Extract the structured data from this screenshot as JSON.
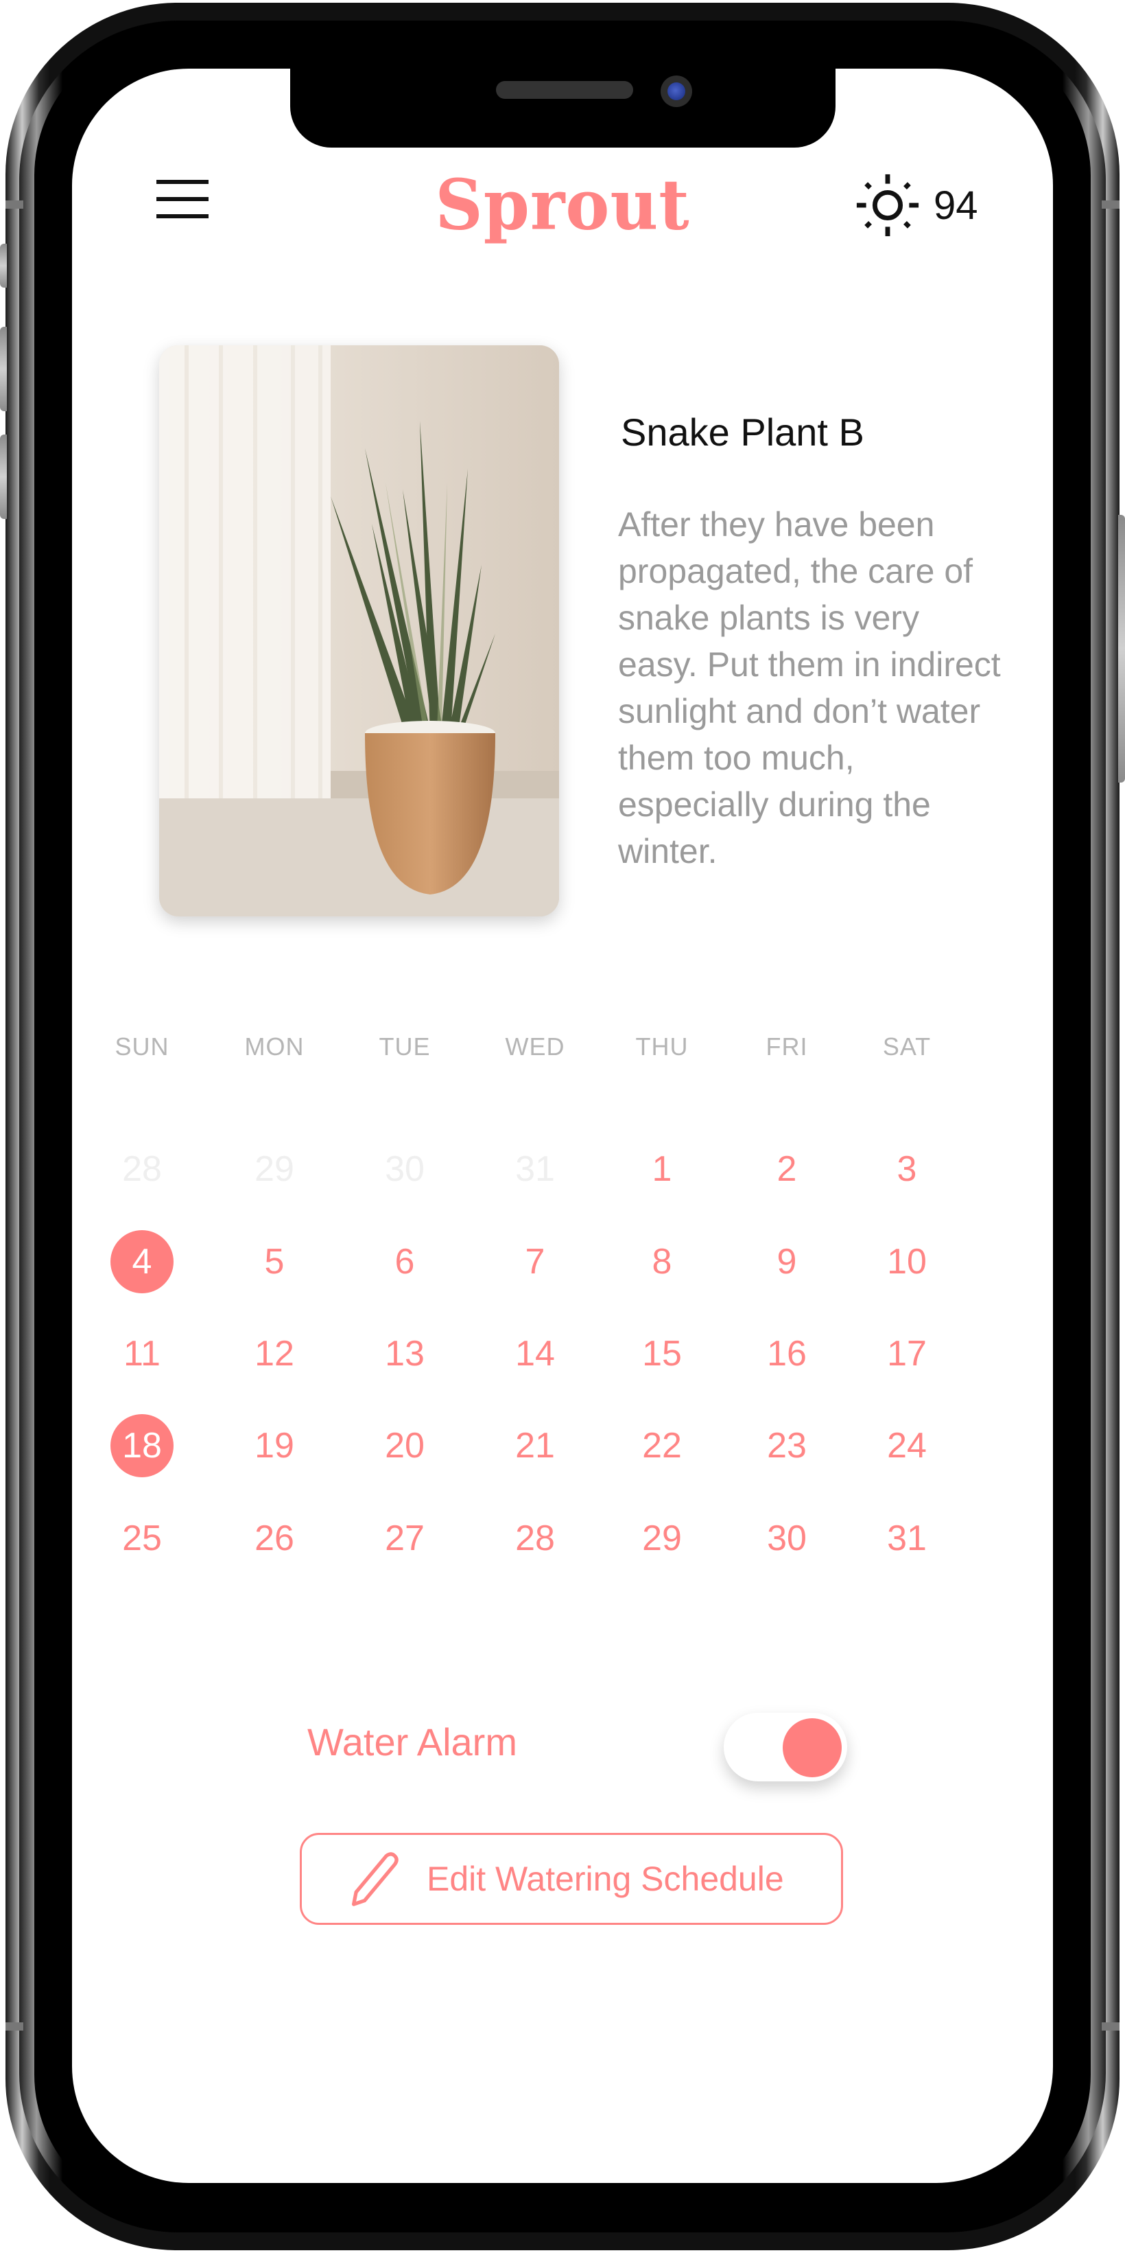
{
  "header": {
    "menu_icon": "hamburger-menu-icon",
    "app_title": "Sprout",
    "weather_icon": "sun-icon",
    "temperature": "94"
  },
  "plant": {
    "image_alt": "Snake plant in terracotta pot beside a curtain",
    "name": "Snake Plant B",
    "description": "After they have been propagated, the care of snake plants is very easy. Put them in indirect sunlight and don’t water them too much, especially during the winter."
  },
  "calendar": {
    "weekdays": [
      "SUN",
      "MON",
      "TUE",
      "WED",
      "THU",
      "FRI",
      "SAT"
    ],
    "weeks": [
      [
        {
          "d": "28",
          "muted": true
        },
        {
          "d": "29",
          "muted": true
        },
        {
          "d": "30",
          "muted": true
        },
        {
          "d": "31",
          "muted": true
        },
        {
          "d": "1"
        },
        {
          "d": "2"
        },
        {
          "d": "3"
        }
      ],
      [
        {
          "d": "4",
          "selected": true
        },
        {
          "d": "5"
        },
        {
          "d": "6"
        },
        {
          "d": "7"
        },
        {
          "d": "8"
        },
        {
          "d": "9"
        },
        {
          "d": "10"
        }
      ],
      [
        {
          "d": "11"
        },
        {
          "d": "12"
        },
        {
          "d": "13"
        },
        {
          "d": "14"
        },
        {
          "d": "15"
        },
        {
          "d": "16"
        },
        {
          "d": "17"
        }
      ],
      [
        {
          "d": "18",
          "selected": true
        },
        {
          "d": "19"
        },
        {
          "d": "20"
        },
        {
          "d": "21"
        },
        {
          "d": "22"
        },
        {
          "d": "23"
        },
        {
          "d": "24"
        }
      ],
      [
        {
          "d": "25"
        },
        {
          "d": "26"
        },
        {
          "d": "27"
        },
        {
          "d": "28"
        },
        {
          "d": "29"
        },
        {
          "d": "30"
        },
        {
          "d": "31"
        }
      ]
    ]
  },
  "controls": {
    "water_alarm_label": "Water Alarm",
    "water_alarm_on": true,
    "edit_button_label": "Edit Watering Schedule",
    "edit_icon": "pencil-icon"
  },
  "colors": {
    "accent": "#ff8585",
    "selected_day": "#ff7f7f",
    "muted_day": "#efefef",
    "weekday_header": "#b5b5b5",
    "description_text": "#9a9a9a"
  }
}
